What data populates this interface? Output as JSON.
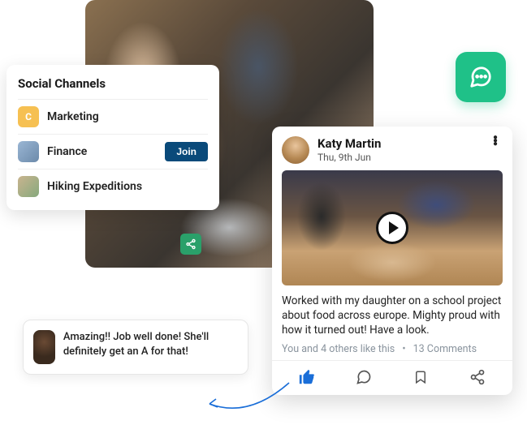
{
  "channels": {
    "title": "Social Channels",
    "items": [
      {
        "icon_letter": "C",
        "label": "Marketing"
      },
      {
        "icon_letter": "",
        "label": "Finance",
        "action": "Join"
      },
      {
        "icon_letter": "",
        "label": "Hiking Expeditions"
      }
    ]
  },
  "post": {
    "author": "Katy Martin",
    "date": "Thu, 9th Jun",
    "body": "Worked with my daughter on a school project about food across europe. Mighty proud with how it turned out! Have a look.",
    "likes_text": "You and 4 others like this",
    "comments_text": "13 Comments"
  },
  "comment": {
    "text": "Amazing!! Job well done! She'll definitely get an A for that!"
  }
}
